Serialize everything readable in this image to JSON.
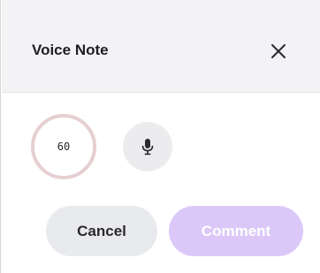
{
  "dialog": {
    "title": "Voice Note",
    "close_icon": "close-icon"
  },
  "recorder": {
    "timer_value": "60",
    "mic_icon": "microphone-icon"
  },
  "actions": {
    "cancel_label": "Cancel",
    "comment_label": "Comment",
    "comment_enabled": false
  },
  "colors": {
    "header_bg": "#f3f3f5",
    "comment_disabled_bg": "#dbc8f8",
    "cancel_bg": "#e9eaee",
    "ring_color": "#e6cfd2"
  }
}
